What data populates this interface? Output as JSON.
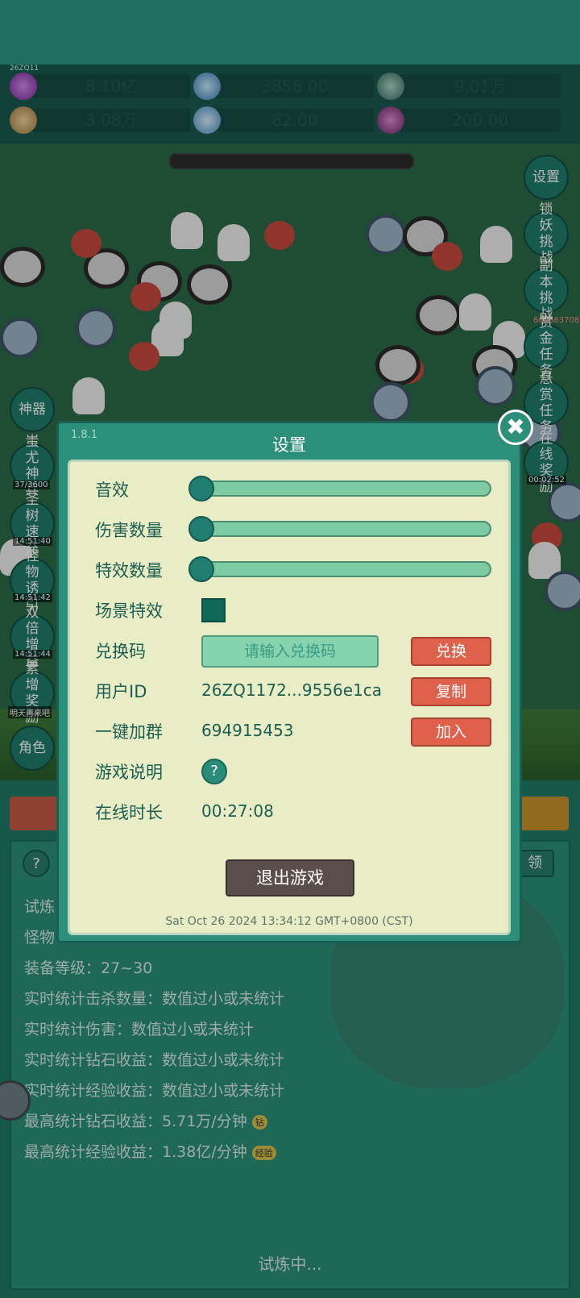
{
  "header": {
    "version_tag": "26ZQ11"
  },
  "resources": [
    {
      "icon": "purple-gem-icon",
      "value": "8.10亿"
    },
    {
      "icon": "blue-crystal-icon",
      "value": "3856.00"
    },
    {
      "icon": "globe-orb-icon",
      "value": "9.01万"
    },
    {
      "icon": "scroll-icon",
      "value": "3.08万"
    },
    {
      "icon": "ice-shard-icon",
      "value": "82.00"
    },
    {
      "icon": "purple-pouch-icon",
      "value": "200.00"
    }
  ],
  "side_right": [
    {
      "label": "设置"
    },
    {
      "label": "锁妖挑战"
    },
    {
      "label": "副本挑战"
    },
    {
      "label": "赏金任务"
    },
    {
      "label": "悬赏任务"
    },
    {
      "label": "在线奖励",
      "timer": "00:02:52"
    }
  ],
  "side_left": [
    {
      "label": "神器"
    },
    {
      "label": "蚩尤神兵",
      "timer": "37/3600"
    },
    {
      "label": "圣树速充",
      "timer": "14:51:40"
    },
    {
      "label": "怪物诱引",
      "timer": "14:51:42"
    },
    {
      "label": "双倍增益",
      "timer": "14:51:44"
    },
    {
      "label": "累增奖励",
      "timer": "明天再来吧"
    },
    {
      "label": "角色"
    }
  ],
  "battle_counter": "666663708",
  "settings": {
    "version": "1.8.1",
    "title": "设置",
    "sound_label": "音效",
    "sound_level": 0,
    "damage_label": "伤害数量",
    "damage_level": 0,
    "effects_label": "特效数量",
    "effects_level": 0,
    "scene_label": "场景特效",
    "redeem_label": "兑换码",
    "redeem_placeholder": "请输入兑换码",
    "redeem_button": "兑换",
    "userid_label": "用户ID",
    "userid_value": "26ZQ1172...9556e1ca",
    "copy_button": "复制",
    "group_label": "一键加群",
    "group_value": "694915453",
    "join_button": "加入",
    "help_label": "游戏说明",
    "help_icon": "?",
    "online_label": "在线时长",
    "online_value": "00:27:08",
    "exit_button": "退出游戏",
    "datetime": "Sat Oct 26 2024 13:34:12 GMT+0800 (CST)",
    "close_icon": "✖"
  },
  "panel": {
    "help_icon": "?",
    "right_tab": "领",
    "lines": [
      {
        "text": "试炼"
      },
      {
        "text": "怪物"
      },
      {
        "text": "装备等级：27~30"
      },
      {
        "text": "实时统计击杀数量：数值过小或未统计"
      },
      {
        "text": "实时统计伤害：数值过小或未统计"
      },
      {
        "text": "实时统计钻石收益：数值过小或未统计"
      },
      {
        "text": "实时统计经验收益：数值过小或未统计"
      },
      {
        "text": "最高统计钻石收益：5.71万/分钟",
        "badge": "钻"
      },
      {
        "text": "最高统计经验收益：1.38亿/分钟",
        "badge": "经验"
      }
    ],
    "status": "试炼中..."
  }
}
